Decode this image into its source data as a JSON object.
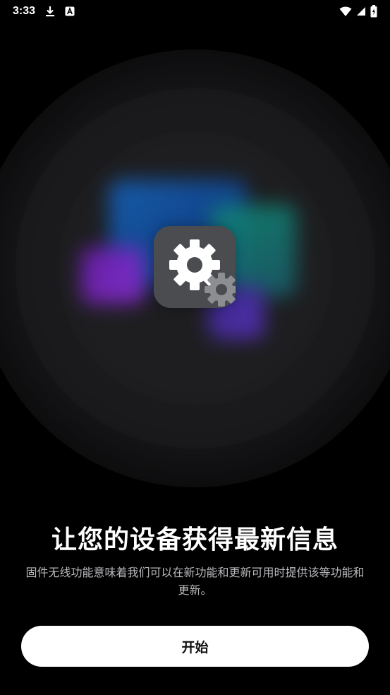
{
  "status_bar": {
    "time": "3:33",
    "left_icons": [
      "download-icon",
      "font-a-icon"
    ],
    "right_icons": [
      "wifi-icon",
      "signal-icon",
      "battery-charging-icon"
    ]
  },
  "hero": {
    "icon": "settings-gear-icon",
    "accent_colors": [
      "#1565c0",
      "#0f8a78",
      "#6a1fb0",
      "#3e2a9a"
    ]
  },
  "content": {
    "title": "让您的设备获得最新信息",
    "description": "固件无线功能意味着我们可以在新功能和更新可用时提供该等功能和更新。"
  },
  "actions": {
    "start_label": "开始"
  }
}
